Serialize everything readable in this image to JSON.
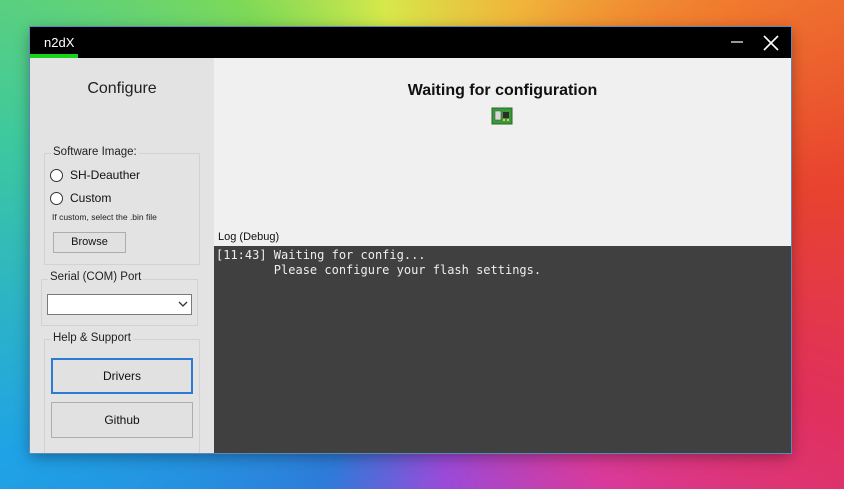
{
  "window": {
    "title": "n2dX"
  },
  "titlebar": {
    "minimize_icon": "minimize-icon",
    "close_icon": "close-icon"
  },
  "sidebar": {
    "title": "Configure",
    "software_image": {
      "legend": "Software Image:",
      "options": [
        "SH-Deauther",
        "Custom"
      ],
      "selected": null,
      "hint": "If custom, select the .bin file",
      "browse_label": "Browse"
    },
    "serial": {
      "legend": "Serial (COM) Port",
      "value": ""
    },
    "help": {
      "legend": "Help & Support",
      "drivers_label": "Drivers",
      "github_label": "Github"
    }
  },
  "main": {
    "status_title": "Waiting for configuration",
    "status_icon": "circuit-board-icon",
    "log_label": "Log (Debug)",
    "log_lines": [
      "[11:43] Waiting for config...",
      "        Please configure your flash settings."
    ]
  },
  "colors": {
    "accent": "#19d219",
    "log_bg": "#404040",
    "focus": "#2b7bd4"
  }
}
